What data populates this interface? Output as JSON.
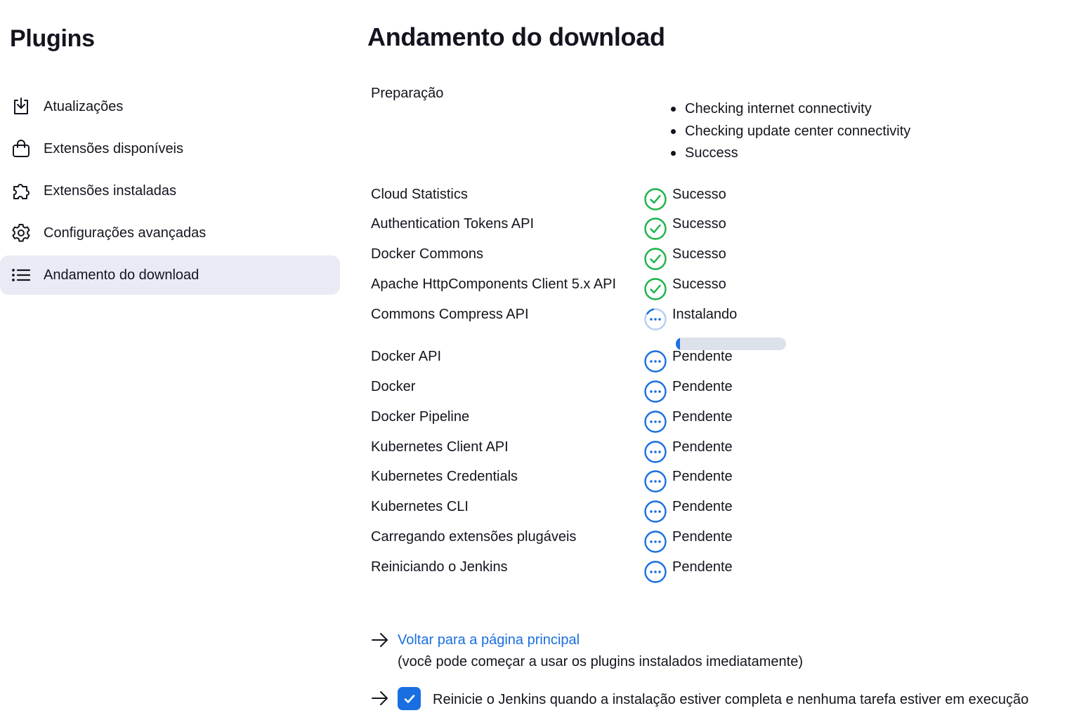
{
  "sidebar": {
    "title": "Plugins",
    "items": [
      {
        "label": "Atualizações",
        "icon": "download-icon",
        "active": false
      },
      {
        "label": "Extensões disponíveis",
        "icon": "shopping-bag-icon",
        "active": false
      },
      {
        "label": "Extensões instaladas",
        "icon": "puzzle-icon",
        "active": false
      },
      {
        "label": "Configurações avançadas",
        "icon": "gear-icon",
        "active": false
      },
      {
        "label": "Andamento do download",
        "icon": "list-icon",
        "active": true
      }
    ]
  },
  "main": {
    "title": "Andamento do download",
    "preparation": {
      "label": "Preparação",
      "steps": [
        "Checking internet connectivity",
        "Checking update center connectivity",
        "Success"
      ]
    },
    "plugins": [
      {
        "name": "Cloud Statistics",
        "status": "Sucesso",
        "state": "success"
      },
      {
        "name": "Authentication Tokens API",
        "status": "Sucesso",
        "state": "success"
      },
      {
        "name": "Docker Commons",
        "status": "Sucesso",
        "state": "success"
      },
      {
        "name": "Apache HttpComponents Client 5.x API",
        "status": "Sucesso",
        "state": "success"
      },
      {
        "name": "Commons Compress API",
        "status": "Instalando",
        "state": "installing",
        "progress": 0.04
      },
      {
        "name": "Docker API",
        "status": "Pendente",
        "state": "pending"
      },
      {
        "name": "Docker",
        "status": "Pendente",
        "state": "pending"
      },
      {
        "name": "Docker Pipeline",
        "status": "Pendente",
        "state": "pending"
      },
      {
        "name": "Kubernetes Client API",
        "status": "Pendente",
        "state": "pending"
      },
      {
        "name": "Kubernetes Credentials",
        "status": "Pendente",
        "state": "pending"
      },
      {
        "name": "Kubernetes CLI",
        "status": "Pendente",
        "state": "pending"
      },
      {
        "name": "Carregando extensões plugáveis",
        "status": "Pendente",
        "state": "pending"
      },
      {
        "name": "Reiniciando o Jenkins",
        "status": "Pendente",
        "state": "pending"
      }
    ],
    "footer": {
      "back_link": "Voltar para a página principal",
      "back_note": "(você pode começar a usar os plugins instalados imediatamente)",
      "restart_label": "Reinicie o Jenkins quando a instalação estiver completa e nenhuma tarefa estiver em execução",
      "restart_checked": true
    }
  },
  "colors": {
    "success": "#1ab34a",
    "pending": "#1a6fe0",
    "link": "#1a6fe0",
    "active_nav_bg": "#e8ebf3",
    "progress_track": "#dde1ea"
  }
}
